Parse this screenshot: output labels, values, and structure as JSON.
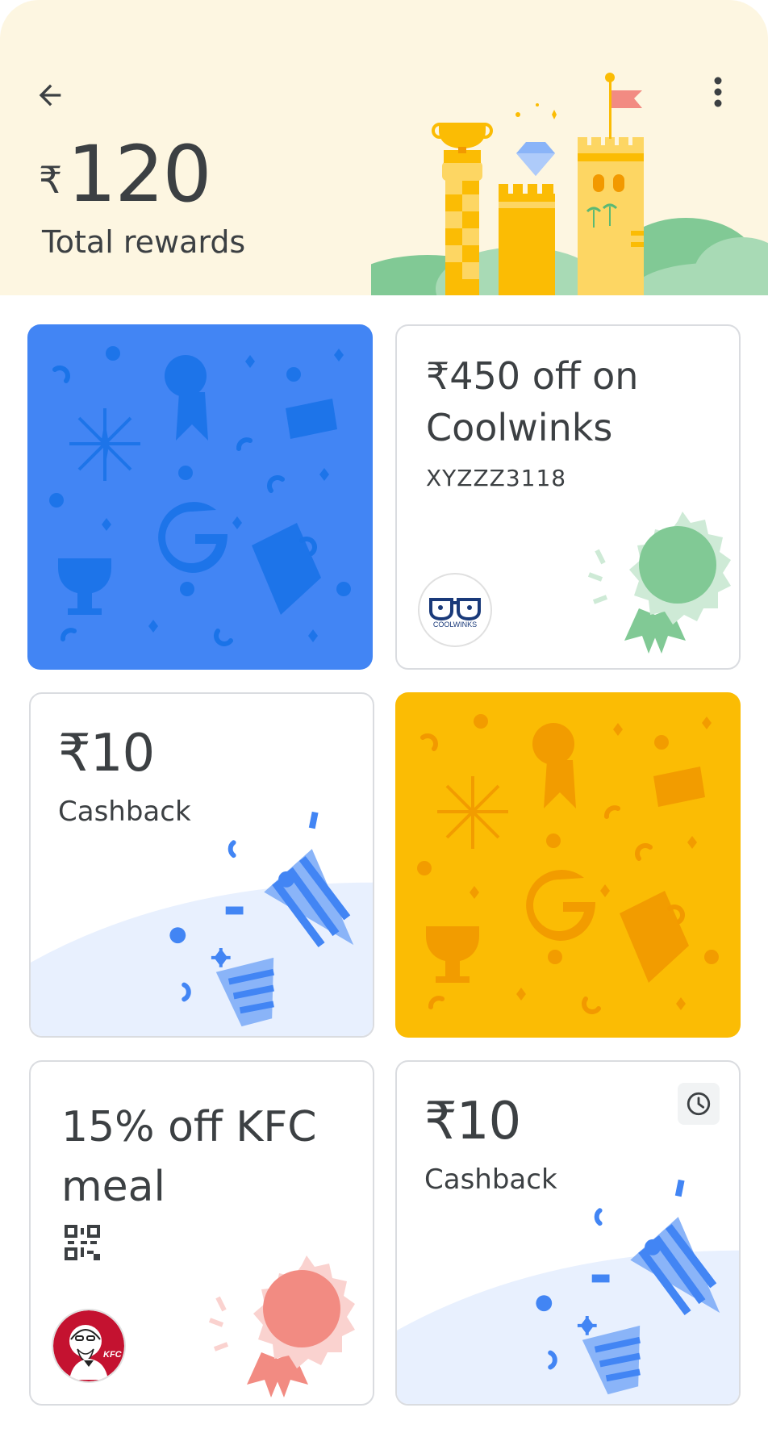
{
  "header": {
    "currency_symbol": "₹",
    "total_amount": "120",
    "total_label": "Total rewards"
  },
  "cards": [
    {
      "type": "unscratched",
      "color": "#4285f4"
    },
    {
      "type": "offer",
      "title": "₹450 off on Coolwinks",
      "code": "XYZZZ3118",
      "brand_logo_text": "COOLWINKS",
      "ribbon_color": "#81c995"
    },
    {
      "type": "cashback",
      "amount": "₹10",
      "label": "Cashback"
    },
    {
      "type": "unscratched",
      "color": "#fbbc04"
    },
    {
      "type": "offer",
      "title": "15% off KFC meal",
      "brand_logo_text": "KFC",
      "ribbon_color": "#f28b82"
    },
    {
      "type": "cashback",
      "amount": "₹10",
      "label": "Cashback",
      "has_timer": true
    }
  ]
}
